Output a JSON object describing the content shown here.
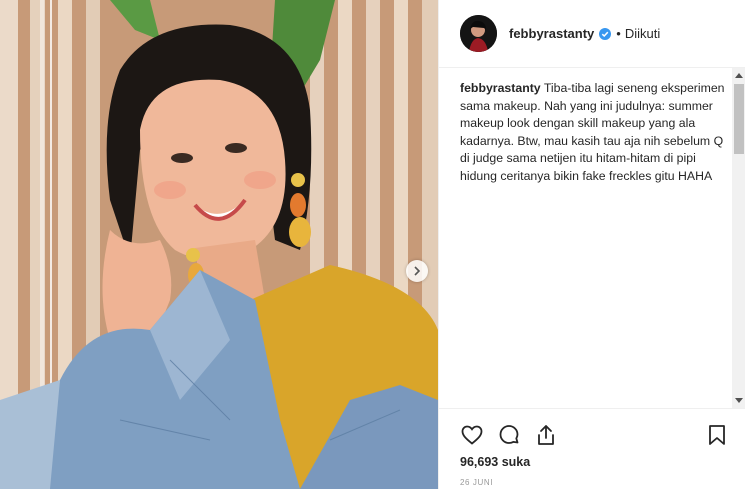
{
  "post": {
    "username": "febbyrastanty",
    "separator": "•",
    "follow_status": "Diikuti",
    "caption_user": "febbyrastanty",
    "caption_text": "Tiba-tiba lagi seneng eksperimen sama makeup. Nah yang ini judulnya: summer makeup look dengan skill makeup yang ala kadarnya. Btw, mau kasih tau aja nih sebelum Q di judge sama netijen itu hitam-hitam di pipi hidung ceritanya bikin fake freckles gitu HAHA",
    "likes": "96,693 suka",
    "date": "26 JUNI"
  },
  "icons": {
    "verified": "verified-badge-icon",
    "like": "heart-icon",
    "comment": "comment-icon",
    "share": "share-icon",
    "save": "bookmark-icon",
    "next": "chevron-right-icon"
  },
  "colors": {
    "verified_blue": "#3897f0",
    "text": "#262626",
    "muted": "#999999"
  }
}
